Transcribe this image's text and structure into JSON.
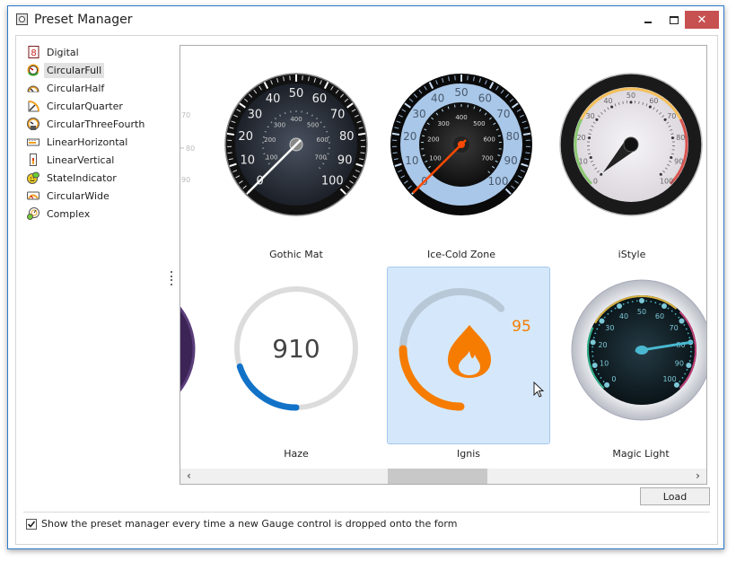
{
  "window": {
    "title": "Preset Manager",
    "controls": {
      "minimize": "minimize",
      "maximize": "maximize",
      "close": "✕"
    }
  },
  "tree": {
    "items": [
      {
        "label": "Digital",
        "icon": "digital-gauge-icon",
        "selected": false
      },
      {
        "label": "CircularFull",
        "icon": "circular-full-gauge-icon",
        "selected": true
      },
      {
        "label": "CircularHalf",
        "icon": "circular-half-gauge-icon",
        "selected": false
      },
      {
        "label": "CircularQuarter",
        "icon": "circular-quarter-gauge-icon",
        "selected": false
      },
      {
        "label": "CircularThreeFourth",
        "icon": "circular-three-fourth-gauge-icon",
        "selected": false
      },
      {
        "label": "LinearHorizontal",
        "icon": "linear-horizontal-gauge-icon",
        "selected": false
      },
      {
        "label": "LinearVertical",
        "icon": "linear-vertical-gauge-icon",
        "selected": false
      },
      {
        "label": "StateIndicator",
        "icon": "state-indicator-gauge-icon",
        "selected": false
      },
      {
        "label": "CircularWide",
        "icon": "circular-wide-gauge-icon",
        "selected": false
      },
      {
        "label": "Complex",
        "icon": "complex-gauge-icon",
        "selected": false
      }
    ]
  },
  "gallery": {
    "partial_left_scale": [
      "70",
      "80",
      "90"
    ],
    "presets": [
      {
        "name": "Gothic Mat",
        "outer_scale": [
          "0",
          "10",
          "20",
          "30",
          "40",
          "50",
          "60",
          "70",
          "80",
          "90",
          "100"
        ],
        "inner_scale": [
          "100",
          "200",
          "300",
          "400",
          "500",
          "600",
          "700"
        ],
        "value": 0,
        "selected": false
      },
      {
        "name": "Ice-Cold Zone",
        "outer_scale": [
          "0",
          "10",
          "20",
          "30",
          "40",
          "50",
          "60",
          "70",
          "80",
          "90",
          "100"
        ],
        "inner_scale": [
          "100",
          "200",
          "300",
          "400",
          "500",
          "600",
          "700"
        ],
        "value": 0,
        "selected": false
      },
      {
        "name": "iStyle",
        "outer_scale": [
          "0",
          "10",
          "20",
          "30",
          "40",
          "50",
          "60",
          "70",
          "80",
          "90",
          "100"
        ],
        "value": 0,
        "selected": false
      },
      {
        "name": "Haze",
        "display_value": "910",
        "fill_fraction": 0.25,
        "selected": false
      },
      {
        "name": "Ignis",
        "display_value": "95",
        "fill_fraction": 0.35,
        "selected": true
      },
      {
        "name": "Magic Light",
        "outer_scale": [
          "0",
          "10",
          "20",
          "30",
          "40",
          "50",
          "60",
          "70",
          "80",
          "90",
          "100"
        ],
        "value": 80,
        "selected": false
      }
    ],
    "colors": {
      "haze_accent": "#1272c8",
      "ignis_accent": "#f57c00",
      "ice_needle": "#ff4a00",
      "ice_face": "#a9c7e8",
      "magic_accent": "#4ab8d0",
      "selection_bg": "#d5e8fb"
    }
  },
  "scrollbar": {
    "left_arrow": "‹",
    "right_arrow": "›"
  },
  "buttons": {
    "load": "Load"
  },
  "footer": {
    "checkbox_checked": true,
    "checkbox_label": "Show the preset manager every time a new Gauge control is dropped onto the form"
  }
}
